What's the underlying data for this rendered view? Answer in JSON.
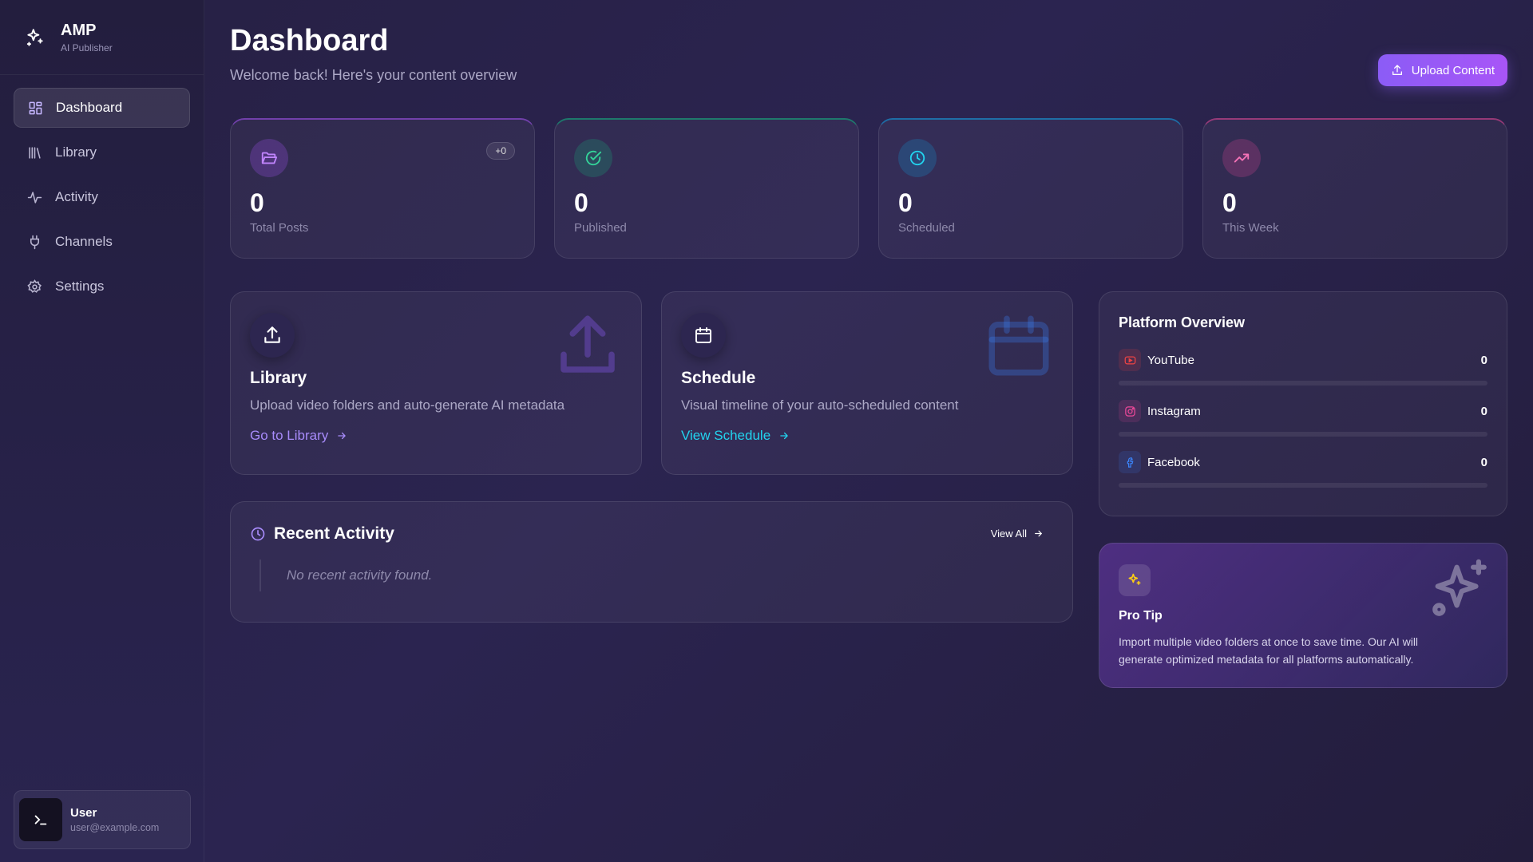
{
  "brand": {
    "title": "AMP",
    "subtitle": "AI Publisher"
  },
  "nav": {
    "items": [
      {
        "label": "Dashboard",
        "icon": "dashboard-icon",
        "active": true
      },
      {
        "label": "Library",
        "icon": "library-icon"
      },
      {
        "label": "Activity",
        "icon": "activity-icon"
      },
      {
        "label": "Channels",
        "icon": "plug-icon"
      },
      {
        "label": "Settings",
        "icon": "gear-icon"
      }
    ]
  },
  "user": {
    "name": "User",
    "email": "user@example.com"
  },
  "header": {
    "title": "Dashboard",
    "subtitle": "Welcome back! Here's your content overview",
    "upload_label": "Upload Content"
  },
  "stats": [
    {
      "value": "0",
      "label": "Total Posts",
      "badge": "+0",
      "icon": "folder-icon",
      "color": "#c084fc"
    },
    {
      "value": "0",
      "label": "Published",
      "icon": "check-circle-icon",
      "color": "#34d399"
    },
    {
      "value": "0",
      "label": "Scheduled",
      "icon": "clock-icon",
      "color": "#22d3ee"
    },
    {
      "value": "0",
      "label": "This Week",
      "icon": "trending-up-icon",
      "color": "#f472b6"
    }
  ],
  "features": {
    "library": {
      "title": "Library",
      "description": "Upload video folders and auto-generate AI metadata",
      "link": "Go to Library",
      "link_color": "#a78bfa"
    },
    "schedule": {
      "title": "Schedule",
      "description": "Visual timeline of your auto-scheduled content",
      "link": "View Schedule",
      "link_color": "#22d3ee"
    }
  },
  "activity": {
    "title": "Recent Activity",
    "view_all": "View All",
    "empty": "No recent activity found."
  },
  "platforms": {
    "title": "Platform Overview",
    "items": [
      {
        "name": "YouTube",
        "count": "0",
        "color": "#ef4444",
        "icon": "youtube-icon"
      },
      {
        "name": "Instagram",
        "count": "0",
        "color": "#ec4899",
        "icon": "instagram-icon"
      },
      {
        "name": "Facebook",
        "count": "0",
        "color": "#3b82f6",
        "icon": "facebook-icon"
      }
    ]
  },
  "tip": {
    "title": "Pro Tip",
    "text": "Import multiple video folders at once to save time. Our AI will generate optimized metadata for all platforms automatically."
  }
}
